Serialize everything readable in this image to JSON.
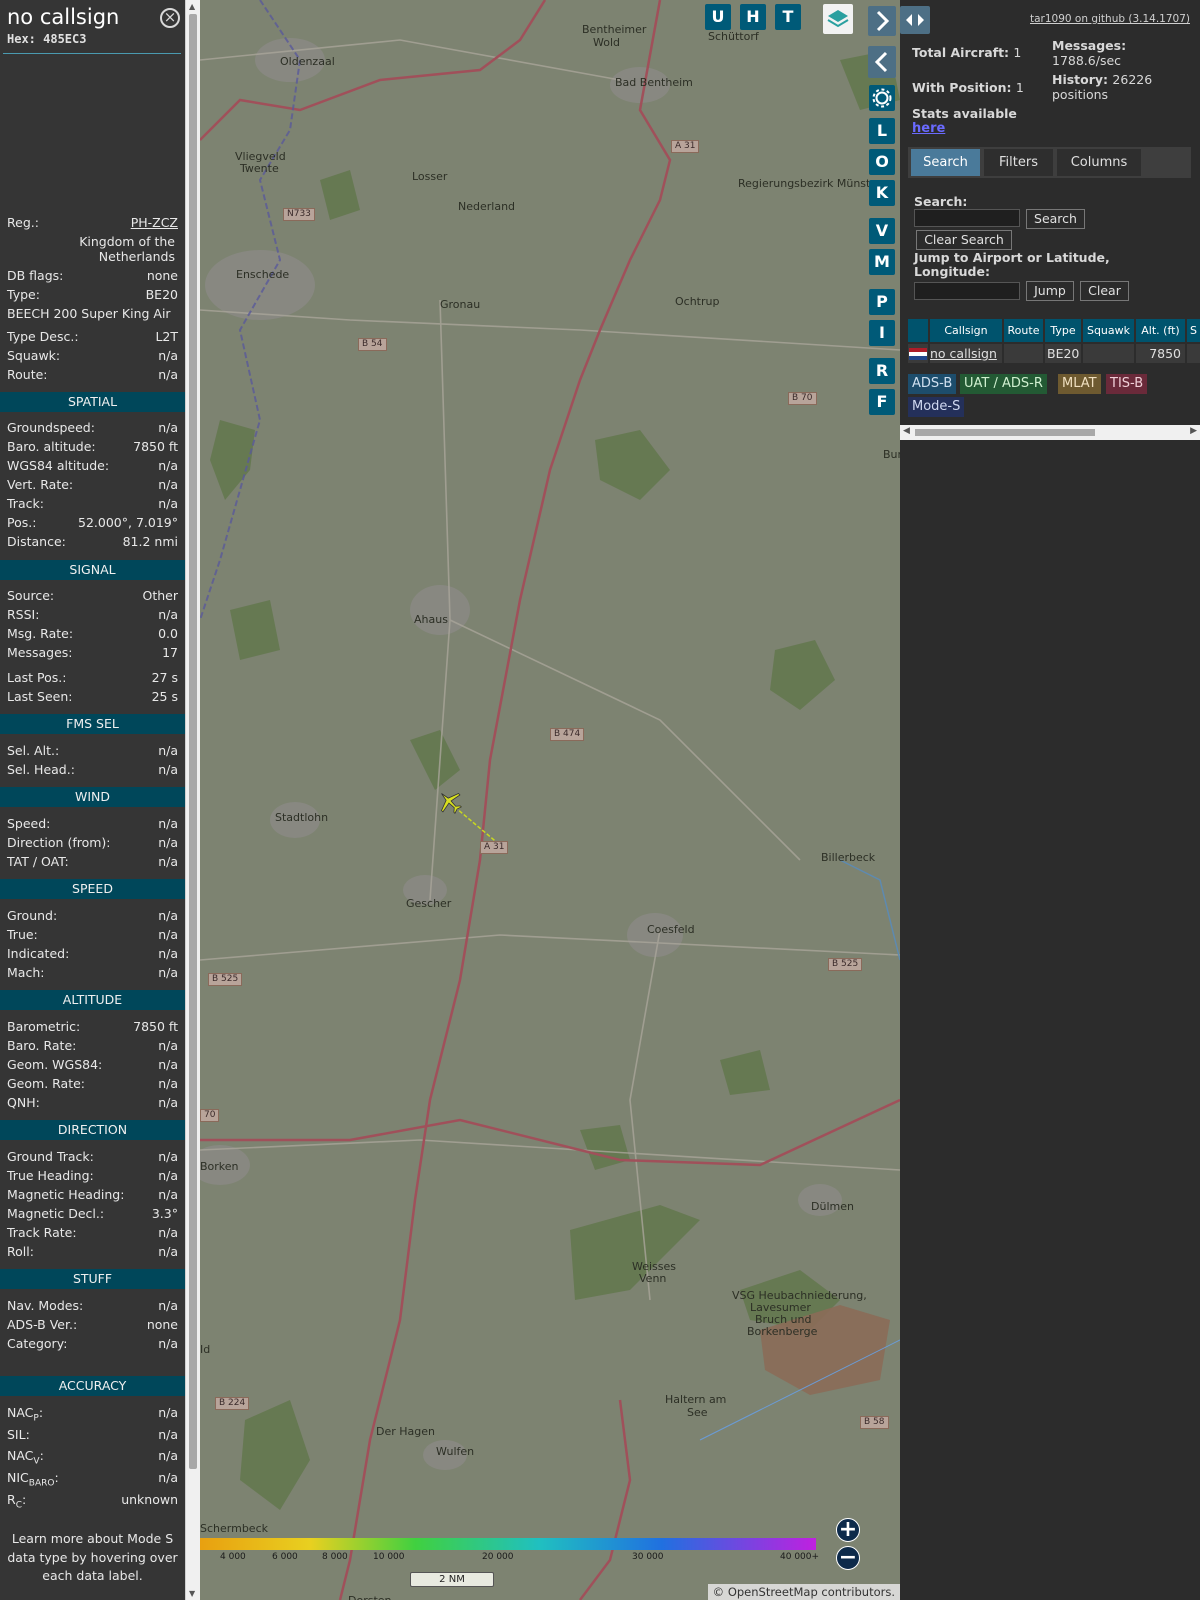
{
  "aircraft": {
    "callsign": "no callsign",
    "hex": "Hex: 485EC3",
    "close_icon": "close-icon"
  },
  "details": {
    "reg_label": "Reg.:",
    "reg_value": "PH-ZCZ",
    "country": [
      "Kingdom of the",
      "Netherlands"
    ],
    "dbflags_label": "DB flags:",
    "dbflags_value": "none",
    "type_label": "Type:",
    "type_value": "BE20",
    "type_full": "BEECH 200 Super King Air",
    "typedesc_label": "Type Desc.:",
    "typedesc_value": "L2T",
    "squawk_label": "Squawk:",
    "squawk_value": "n/a",
    "route_label": "Route:",
    "route_value": "n/a"
  },
  "sections": {
    "spatial": "SPATIAL",
    "signal": "SIGNAL",
    "fms": "FMS SEL",
    "wind": "WIND",
    "speed": "SPEED",
    "altitude": "ALTITUDE",
    "direction": "DIRECTION",
    "stuff": "STUFF",
    "accuracy": "ACCURACY"
  },
  "spatial": [
    [
      "Groundspeed:",
      "n/a"
    ],
    [
      "Baro. altitude:",
      "7850 ft"
    ],
    [
      "WGS84 altitude:",
      "n/a"
    ],
    [
      "Vert. Rate:",
      "n/a"
    ],
    [
      "Track:",
      "n/a"
    ],
    [
      "Pos.:",
      "52.000°, 7.019°"
    ],
    [
      "Distance:",
      "81.2 nmi"
    ]
  ],
  "signal": [
    [
      "Source:",
      "Other"
    ],
    [
      "RSSI:",
      "n/a"
    ],
    [
      "Msg. Rate:",
      "0.0"
    ],
    [
      "Messages:",
      "17"
    ],
    [
      "Last Pos.:",
      "27 s"
    ],
    [
      "Last Seen:",
      "25 s"
    ]
  ],
  "fms": [
    [
      "Sel. Alt.:",
      "n/a"
    ],
    [
      "Sel. Head.:",
      "n/a"
    ]
  ],
  "wind": [
    [
      "Speed:",
      "n/a"
    ],
    [
      "Direction (from):",
      "n/a"
    ],
    [
      "TAT / OAT:",
      "n/a"
    ]
  ],
  "speed": [
    [
      "Ground:",
      "n/a"
    ],
    [
      "True:",
      "n/a"
    ],
    [
      "Indicated:",
      "n/a"
    ],
    [
      "Mach:",
      "n/a"
    ]
  ],
  "altitude": [
    [
      "Barometric:",
      "7850 ft"
    ],
    [
      "Baro. Rate:",
      "n/a"
    ],
    [
      "Geom. WGS84:",
      "n/a"
    ],
    [
      "Geom. Rate:",
      "n/a"
    ],
    [
      "QNH:",
      "n/a"
    ]
  ],
  "direction": [
    [
      "Ground Track:",
      "n/a"
    ],
    [
      "True Heading:",
      "n/a"
    ],
    [
      "Magnetic Heading:",
      "n/a"
    ],
    [
      "Magnetic Decl.:",
      "3.3°"
    ],
    [
      "Track Rate:",
      "n/a"
    ],
    [
      "Roll:",
      "n/a"
    ]
  ],
  "stuff": [
    [
      "Nav. Modes:",
      "n/a"
    ],
    [
      "ADS-B Ver.:",
      "none"
    ],
    [
      "Category:",
      "n/a"
    ]
  ],
  "accuracy": {
    "nacp": {
      "base": "NAC",
      "sub": "P",
      "value": "n/a"
    },
    "sil": {
      "base": "SIL:",
      "value": "n/a"
    },
    "nacv": {
      "base": "NAC",
      "sub": "V",
      "value": "n/a"
    },
    "nicbaro": {
      "base": "NIC",
      "sub": "BARO",
      "value": "n/a"
    },
    "rc": {
      "base": "R",
      "sub": "C",
      "value": "unknown"
    }
  },
  "footer_note": "Learn more about Mode S data type by hovering over each data label.",
  "map": {
    "top_buttons": [
      "U",
      "H",
      "T"
    ],
    "side_buttons": [
      "L",
      "O",
      "K",
      "V",
      "M",
      "P",
      "I",
      "R",
      "F"
    ],
    "places": [
      [
        "Oldenzaal",
        80,
        55
      ],
      [
        "Bentheimer",
        382,
        23
      ],
      [
        "Wold",
        393,
        36
      ],
      [
        "Schüttorf",
        508,
        30
      ],
      [
        "Bad Bentheim",
        415,
        76
      ],
      [
        "Vliegveld",
        35,
        150
      ],
      [
        "Twente",
        40,
        162
      ],
      [
        "Losser",
        212,
        170
      ],
      [
        "Regierungsbezirk Münster",
        538,
        177
      ],
      [
        "Enschede",
        36,
        268
      ],
      [
        "Gronau",
        240,
        298
      ],
      [
        "Ochtrup",
        475,
        295
      ],
      [
        "Ahaus",
        214,
        613
      ],
      [
        "Stadtlohn",
        75,
        811
      ],
      [
        "Billerbeck",
        621,
        851
      ],
      [
        "Gescher",
        206,
        897
      ],
      [
        "Coesfeld",
        447,
        923
      ],
      [
        "Borken",
        0,
        1160
      ],
      [
        "Weisses",
        432,
        1260
      ],
      [
        "Venn",
        439,
        1272
      ],
      [
        "Dülmen",
        611,
        1200
      ],
      [
        "VSG Heubachniederung,",
        532,
        1289
      ],
      [
        "Lavesumer",
        550,
        1301
      ],
      [
        "Bruch und",
        555,
        1313
      ],
      [
        "Borkenberge",
        547,
        1325
      ],
      [
        "Haltern am",
        465,
        1393
      ],
      [
        "See",
        487,
        1406
      ],
      [
        "Der Hagen",
        176,
        1425
      ],
      [
        "Wulfen",
        236,
        1445
      ],
      [
        "Schermbeck",
        0,
        1522
      ],
      [
        "Dorsten",
        148,
        1594
      ],
      [
        "Bur",
        683,
        448
      ],
      [
        "Id",
        0,
        1343
      ],
      [
        "Nederland",
        258,
        200
      ]
    ],
    "roads": [
      [
        "A 31",
        471,
        140
      ],
      [
        "N733",
        83,
        208
      ],
      [
        "B 54",
        158,
        338
      ],
      [
        "B 70",
        588,
        392
      ],
      [
        "B 474",
        350,
        728
      ],
      [
        "A 31",
        280,
        841
      ],
      [
        "B 525",
        8,
        973
      ],
      [
        "B 525",
        628,
        958
      ],
      [
        "70",
        0,
        1109
      ],
      [
        "B 224",
        15,
        1397
      ],
      [
        "B 58",
        660,
        1416
      ]
    ],
    "alt_scale": [
      "4 000",
      "6 000",
      "8 000",
      "10 000",
      "20 000",
      "30 000",
      "40 000+"
    ],
    "scale_text": "2 NM",
    "attribution_prefix": "© ",
    "attribution_link": "OpenStreetMap",
    "attribution_suffix": " contributors."
  },
  "right": {
    "github": "tar1090 on github (3.14.1707)",
    "total_label": "Total Aircraft:",
    "total_value": "1",
    "withpos_label": "With Position:",
    "withpos_value": "1",
    "messages_label": "Messages:",
    "messages_value": "1788.6/sec",
    "history_label": "History:",
    "history_value": "26226",
    "history_unit": "positions",
    "stats_text": "Stats available",
    "stats_link": "here",
    "tabs": [
      "Search",
      "Filters",
      "Columns"
    ],
    "search_label": "Search:",
    "search_button": "Search",
    "clear_search": "Clear Search",
    "jump_label_1": "Jump to Airport or Latitude,",
    "jump_label_2": "Longitude:",
    "jump_button": "Jump",
    "clear_button": "Clear",
    "table_headers": [
      "Callsign",
      "Route",
      "Type",
      "Squawk",
      "Alt. (ft)",
      "S"
    ],
    "table_row": {
      "callsign": "no callsign",
      "route": "",
      "type": "BE20",
      "squawk": "",
      "alt": "7850"
    },
    "legend": [
      "ADS-B",
      "UAT / ADS-R",
      "MLAT",
      "TIS-B",
      "Mode-S"
    ]
  }
}
